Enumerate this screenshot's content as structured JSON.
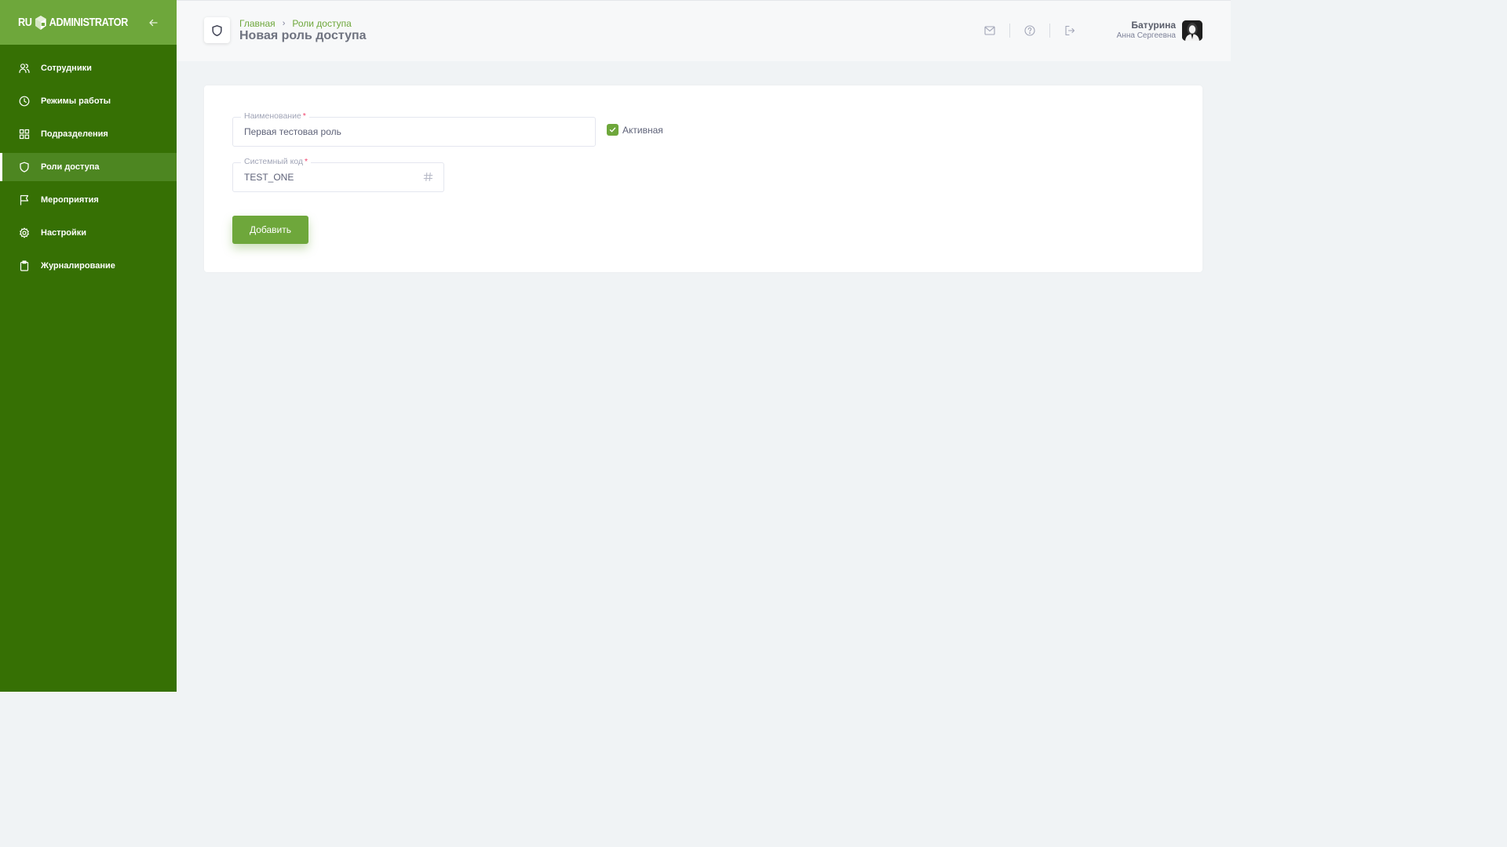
{
  "app": {
    "logo_text": "RU",
    "logo_text2": "ADMINISTRATOR"
  },
  "sidebar": {
    "items": [
      {
        "label": "Сотрудники",
        "icon": "users-icon",
        "active": false
      },
      {
        "label": "Режимы работы",
        "icon": "clock-icon",
        "active": false
      },
      {
        "label": "Подразделения",
        "icon": "grid-icon",
        "active": false
      },
      {
        "label": "Роли доступа",
        "icon": "shield-icon",
        "active": true
      },
      {
        "label": "Мероприятия",
        "icon": "flag-icon",
        "active": false
      },
      {
        "label": "Настройки",
        "icon": "gear-icon",
        "active": false
      },
      {
        "label": "Журналирование",
        "icon": "clipboard-icon",
        "active": false
      }
    ]
  },
  "header": {
    "breadcrumb": [
      "Главная",
      "Роли доступа"
    ],
    "title": "Новая роль доступа"
  },
  "user": {
    "name": "Батурина",
    "subname": "Анна Сергеевна"
  },
  "form": {
    "name_label": "Наименование",
    "name_value": "Первая тестовая роль",
    "code_label": "Системный код",
    "code_value": "TEST_ONE",
    "required_mark": "*",
    "active_label": "Активная",
    "active_checked": true,
    "submit_label": "Добавить"
  },
  "colors": {
    "brand": "#6ea73b",
    "sidebar": "#367004",
    "required": "#f1416c"
  }
}
